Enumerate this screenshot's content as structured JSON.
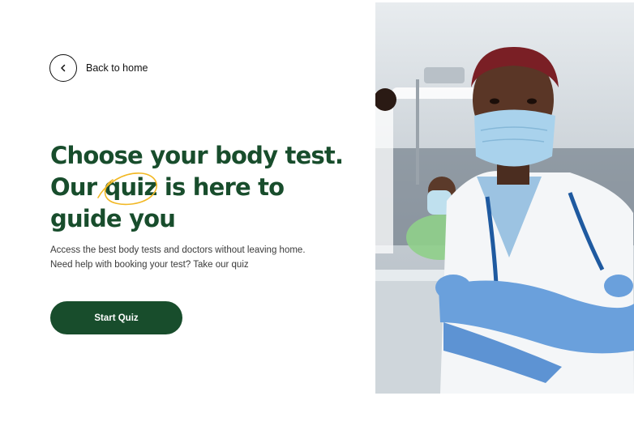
{
  "nav": {
    "back_label": "Back to home",
    "back_icon": "chevron-left-icon"
  },
  "hero": {
    "headline_line1": "Choose your body test.",
    "headline_line2_before": "Our ",
    "headline_highlight": "quiz",
    "headline_line2_after": " is here to",
    "headline_line3": "guide you",
    "description_line1": "Access the best body tests and doctors without leaving home.",
    "description_line2": "Need help with booking your test? Take our quiz",
    "cta_label": "Start Quiz"
  },
  "colors": {
    "brand_green": "#184d2c",
    "highlight_circle": "#f2b824",
    "text_dark": "#111111"
  }
}
